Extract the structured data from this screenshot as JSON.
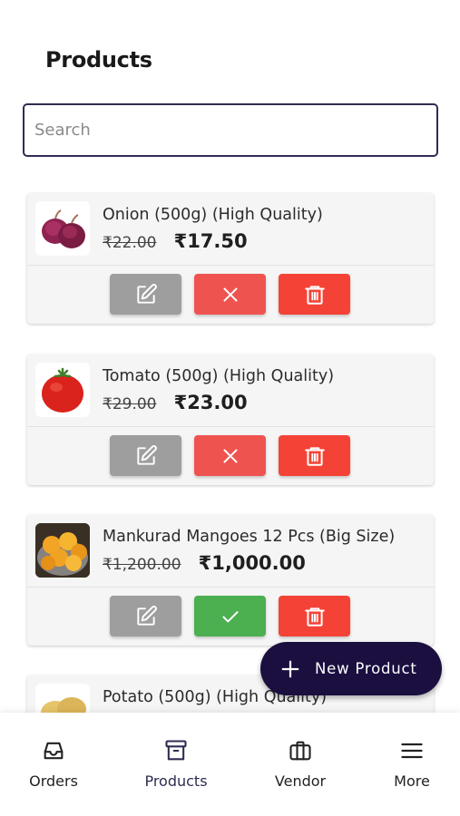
{
  "page": {
    "title": "Products"
  },
  "search": {
    "placeholder": "Search",
    "value": ""
  },
  "currency_symbol": "₹",
  "products": [
    {
      "name": "Onion (500g) (High Quality)",
      "old_price": "₹22.00",
      "new_price": "₹17.50",
      "image_icon": "onion",
      "status_action": "deactivate",
      "status_color": "#ef5350"
    },
    {
      "name": "Tomato (500g) (High Quality)",
      "old_price": "₹29.00",
      "new_price": "₹23.00",
      "image_icon": "tomato",
      "status_action": "deactivate",
      "status_color": "#ef5350"
    },
    {
      "name": "Mankurad Mangoes 12 Pcs (Big Size)",
      "old_price": "₹1,200.00",
      "new_price": "₹1,000.00",
      "image_icon": "mangoes",
      "status_action": "activate",
      "status_color": "#4caf50"
    },
    {
      "name": "Potato (500g) (High Quality)",
      "old_price": "",
      "new_price": "",
      "image_icon": "potato"
    }
  ],
  "fab": {
    "label": "New Product",
    "icon": "plus-icon"
  },
  "bottom_nav": [
    {
      "label": "Orders",
      "icon": "inbox-icon",
      "active": false
    },
    {
      "label": "Products",
      "icon": "archive-icon",
      "active": true
    },
    {
      "label": "Vendor",
      "icon": "briefcase-icon",
      "active": false
    },
    {
      "label": "More",
      "icon": "menu-icon",
      "active": false
    }
  ],
  "colors": {
    "primary": "#2e2d52",
    "fab_bg": "#1a0f3f",
    "edit_button": "#9e9e9e",
    "delete_button": "#f44336",
    "deactivate_button": "#ef5350",
    "activate_button": "#4caf50"
  }
}
